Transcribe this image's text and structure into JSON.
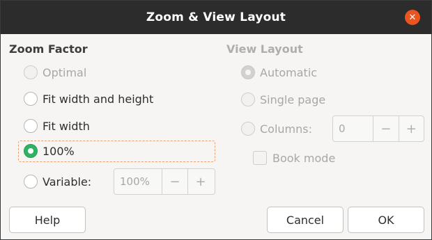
{
  "window": {
    "title": "Zoom & View Layout",
    "close_icon": "close-icon",
    "close_symbol": "✕",
    "accent_color": "#e95420",
    "radio_selected_color": "#2eb364"
  },
  "zoom_factor": {
    "heading": "Zoom Factor",
    "options": [
      {
        "label": "Optimal",
        "enabled": false,
        "selected": false
      },
      {
        "label": "Fit width and height",
        "enabled": true,
        "selected": false
      },
      {
        "label": "Fit width",
        "enabled": true,
        "selected": false
      },
      {
        "label": "100%",
        "enabled": true,
        "selected": true
      },
      {
        "label": "Variable:",
        "enabled": true,
        "selected": false
      }
    ],
    "variable_value": "100%",
    "minus": "−",
    "plus": "+"
  },
  "view_layout": {
    "heading": "View Layout",
    "options": [
      {
        "label": "Automatic",
        "enabled": false,
        "selected": true
      },
      {
        "label": "Single page",
        "enabled": false,
        "selected": false
      },
      {
        "label": "Columns:",
        "enabled": false,
        "selected": false
      }
    ],
    "columns_value": "0",
    "minus": "−",
    "plus": "+",
    "book_mode_label": "Book mode",
    "book_mode_checked": false
  },
  "buttons": {
    "help": "Help",
    "cancel": "Cancel",
    "ok": "OK"
  }
}
